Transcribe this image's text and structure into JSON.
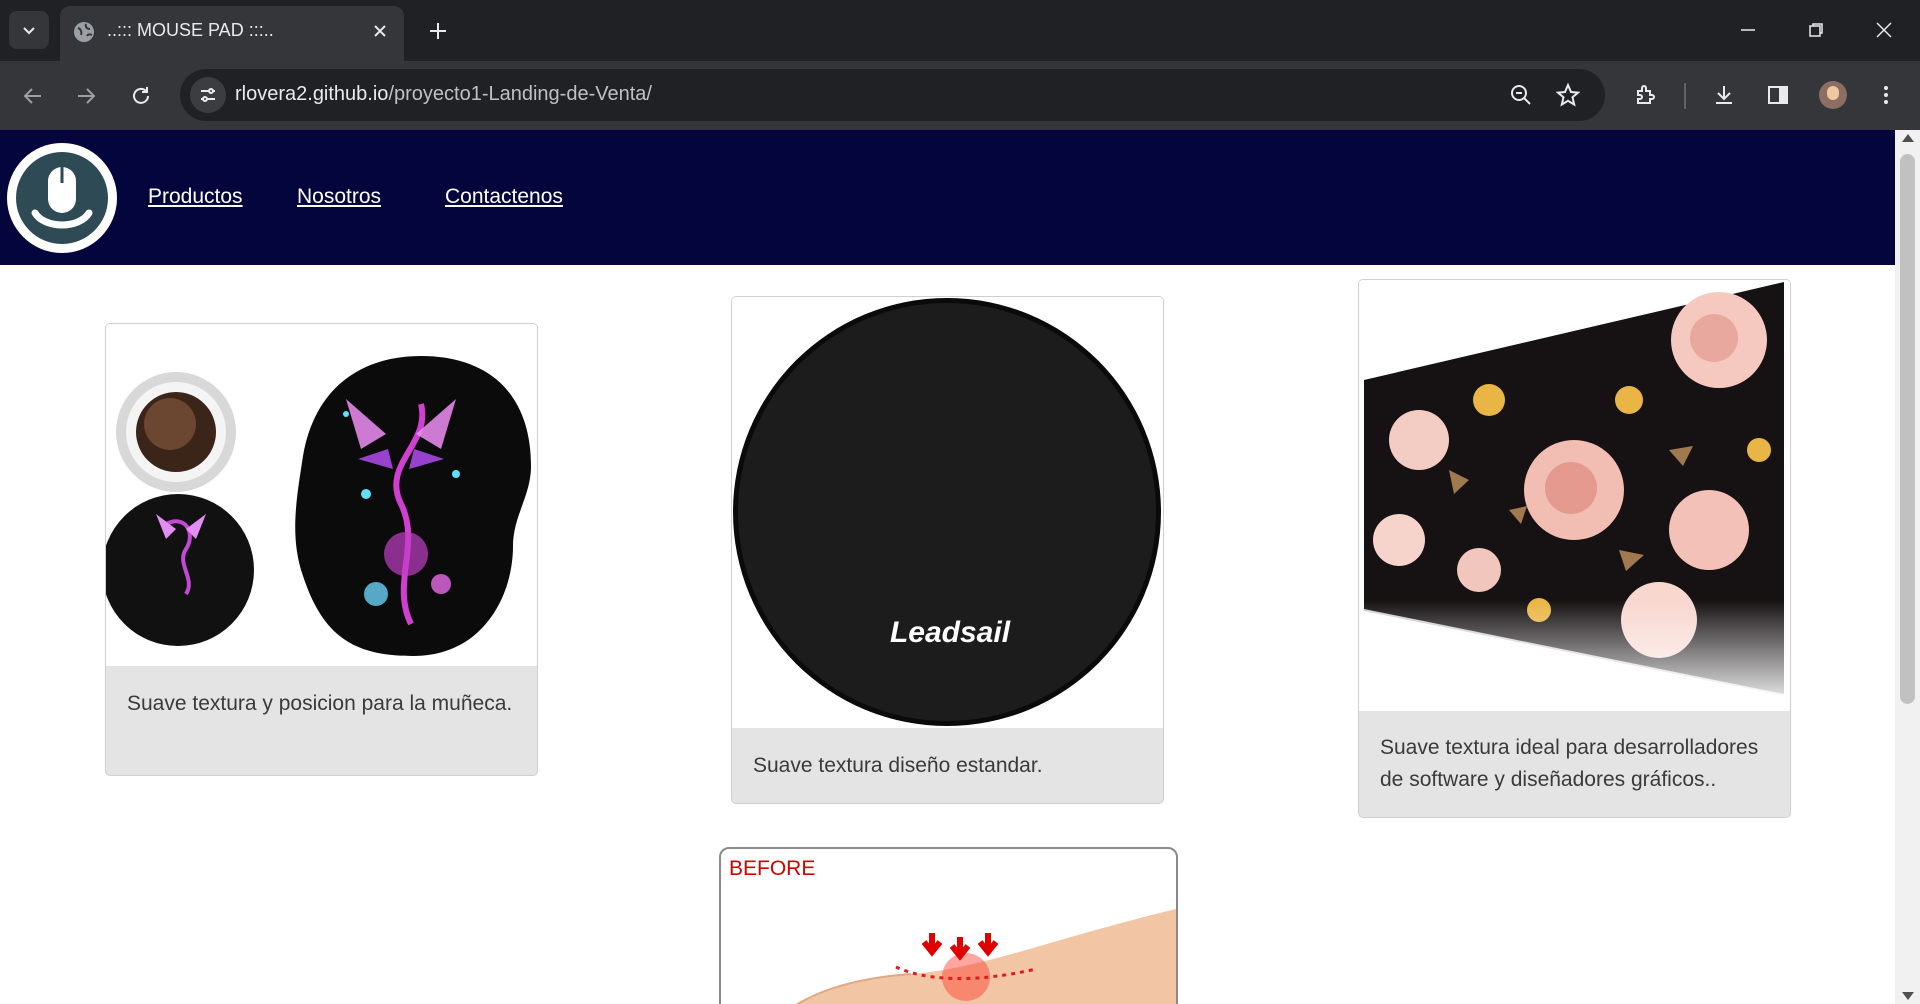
{
  "browser": {
    "tab_title": "..::: MOUSE PAD :::..",
    "url_host": "rlovera2.github.io",
    "url_path": "/proyecto1-Landing-de-Venta/"
  },
  "header": {
    "logo_icon": "mouse-icon",
    "nav": [
      {
        "label": "Productos"
      },
      {
        "label": "Nosotros"
      },
      {
        "label": "Contactenos"
      }
    ],
    "background": "#05053e"
  },
  "products": [
    {
      "image": "butterfly-mousepad-with-wrist-rest",
      "description": "Suave textura y posicion para la muñeca."
    },
    {
      "image": "round-black-mousepad",
      "brand": "Leadsail",
      "description": "Suave textura diseño estandar."
    },
    {
      "image": "floral-desk-mat",
      "description": "Suave textura ideal para desarrolladores de software y diseñadores gráficos.."
    }
  ],
  "before_image": {
    "label": "BEFORE"
  }
}
